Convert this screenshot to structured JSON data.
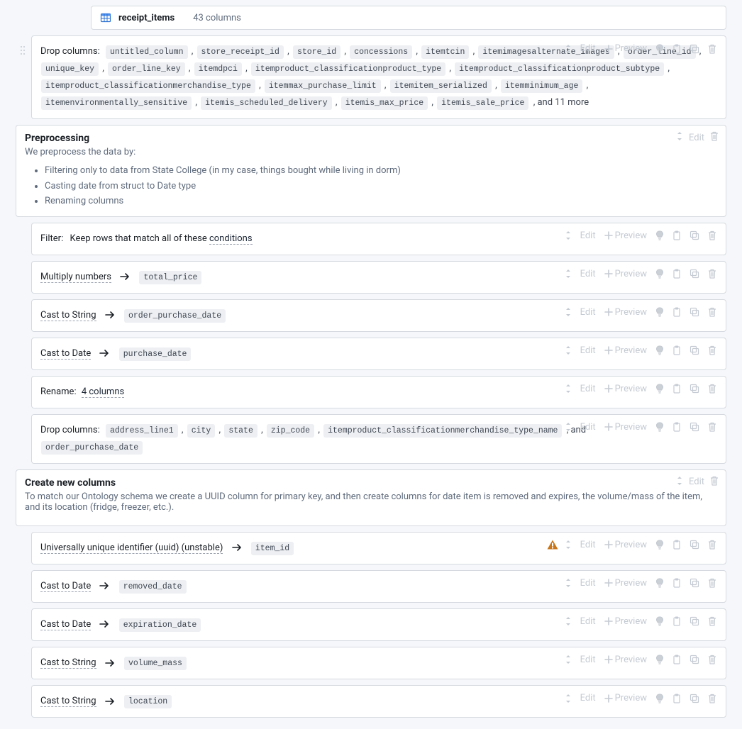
{
  "source": {
    "name": "receipt_items",
    "columns_text": "43 columns"
  },
  "step0": {
    "label": "Drop columns",
    "columns": [
      "untitled_column",
      "store_receipt_id",
      "store_id",
      "concessions",
      "itemtcin",
      "itemimagesalternate_images",
      "order_line_id",
      "unique_key",
      "order_line_key",
      "itemdpci",
      "itemproduct_classificationproduct_type",
      "itemproduct_classificationproduct_subtype",
      "itemproduct_classificationmerchandise_type",
      "itemmax_purchase_limit",
      "itemitem_serialized",
      "itemminimum_age",
      "itemenvironmentally_sensitive",
      "itemis_scheduled_delivery",
      "itemis_max_price",
      "itemis_sale_price"
    ],
    "more": ", and 11 more"
  },
  "section1": {
    "title": "Preprocessing",
    "desc": "We preprocess the data by:",
    "items": [
      "Filtering only to data from State College (in my case, things bought while living in dorm)",
      "Casting date from struct to Date type",
      "Renaming columns"
    ]
  },
  "filter": {
    "label": "Filter",
    "text_a": "Keep rows that match all of these ",
    "cond": "conditions"
  },
  "mul": {
    "label": "Multiply numbers",
    "col": "total_price"
  },
  "cast_str1": {
    "label": "Cast to String",
    "col": "order_purchase_date"
  },
  "cast_date1": {
    "label": "Cast to Date",
    "col": "purchase_date"
  },
  "rename": {
    "label": "Rename",
    "text": "4 columns"
  },
  "drop2": {
    "label": "Drop columns",
    "columns": [
      "address_line1",
      "city",
      "state",
      "zip_code",
      "itemproduct_classificationmerchandise_type_name"
    ],
    "more": ", and",
    "extra": "order_purchase_date"
  },
  "section2": {
    "title": "Create new columns",
    "desc": "To match our Ontology schema we create a UUID column for primary key, and then create columns for date item is removed and expires, the volume/mass of the item, and its location (fridge, freezer, etc.)."
  },
  "uuid": {
    "label": "Universally unique identifier (uuid) (unstable)",
    "col": "item_id"
  },
  "cast_date2": {
    "label": "Cast to Date",
    "col": "removed_date"
  },
  "cast_date3": {
    "label": "Cast to Date",
    "col": "expiration_date"
  },
  "cast_str2": {
    "label": "Cast to String",
    "col": "volume_mass"
  },
  "cast_str3": {
    "label": "Cast to String",
    "col": "location"
  },
  "actions": {
    "edit": "Edit",
    "preview": "Preview"
  }
}
